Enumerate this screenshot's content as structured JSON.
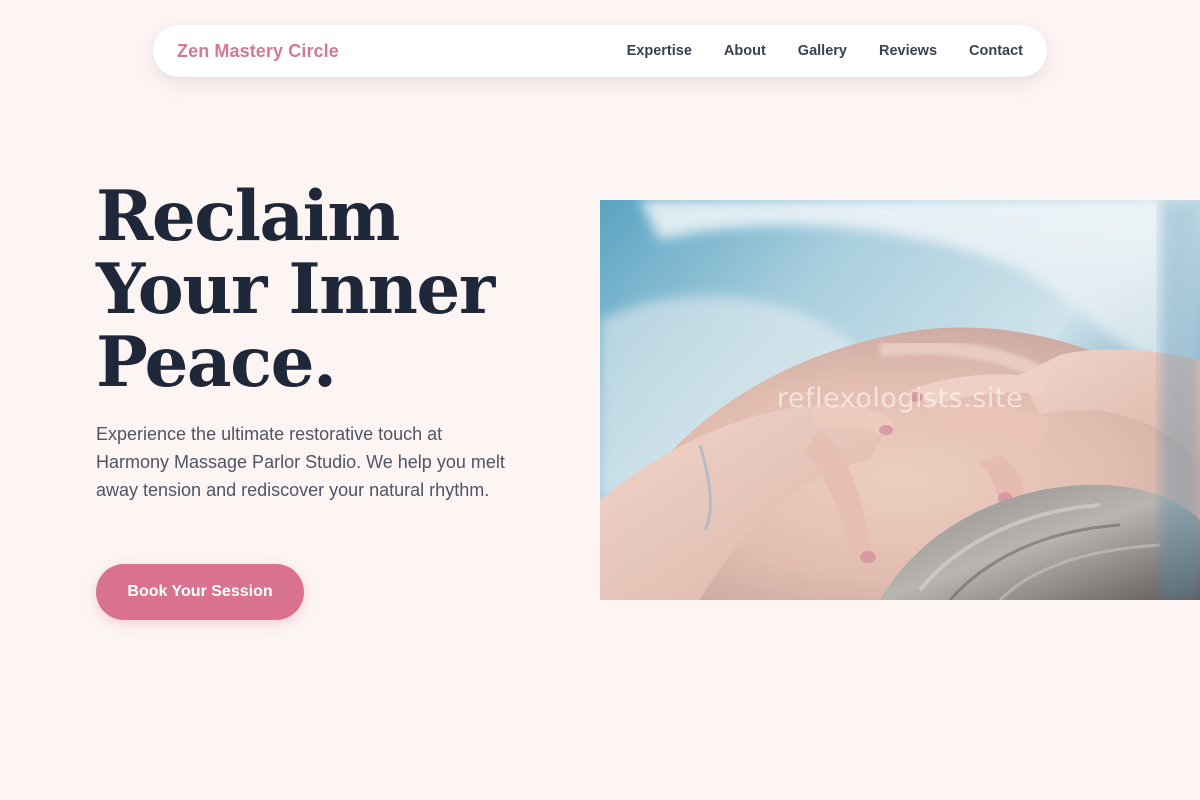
{
  "nav": {
    "brand": "Zen Mastery Circle",
    "links": [
      "Expertise",
      "About",
      "Gallery",
      "Reviews",
      "Contact"
    ]
  },
  "hero": {
    "title_lines": [
      "Reclaim",
      "Your Inner",
      "Peace."
    ],
    "description": "Experience the ultimate restorative touch at Harmony Massage Parlor Studio. We help you melt away tension and rediscover your natural rhythm.",
    "cta_label": "Book Your Session",
    "image_watermark": "reflexologists.site"
  },
  "colors": {
    "background": "#fdf4f4",
    "accent": "#d9728f",
    "brand": "#d07a97",
    "heading": "#1e2838",
    "body_text": "#4e5563"
  }
}
